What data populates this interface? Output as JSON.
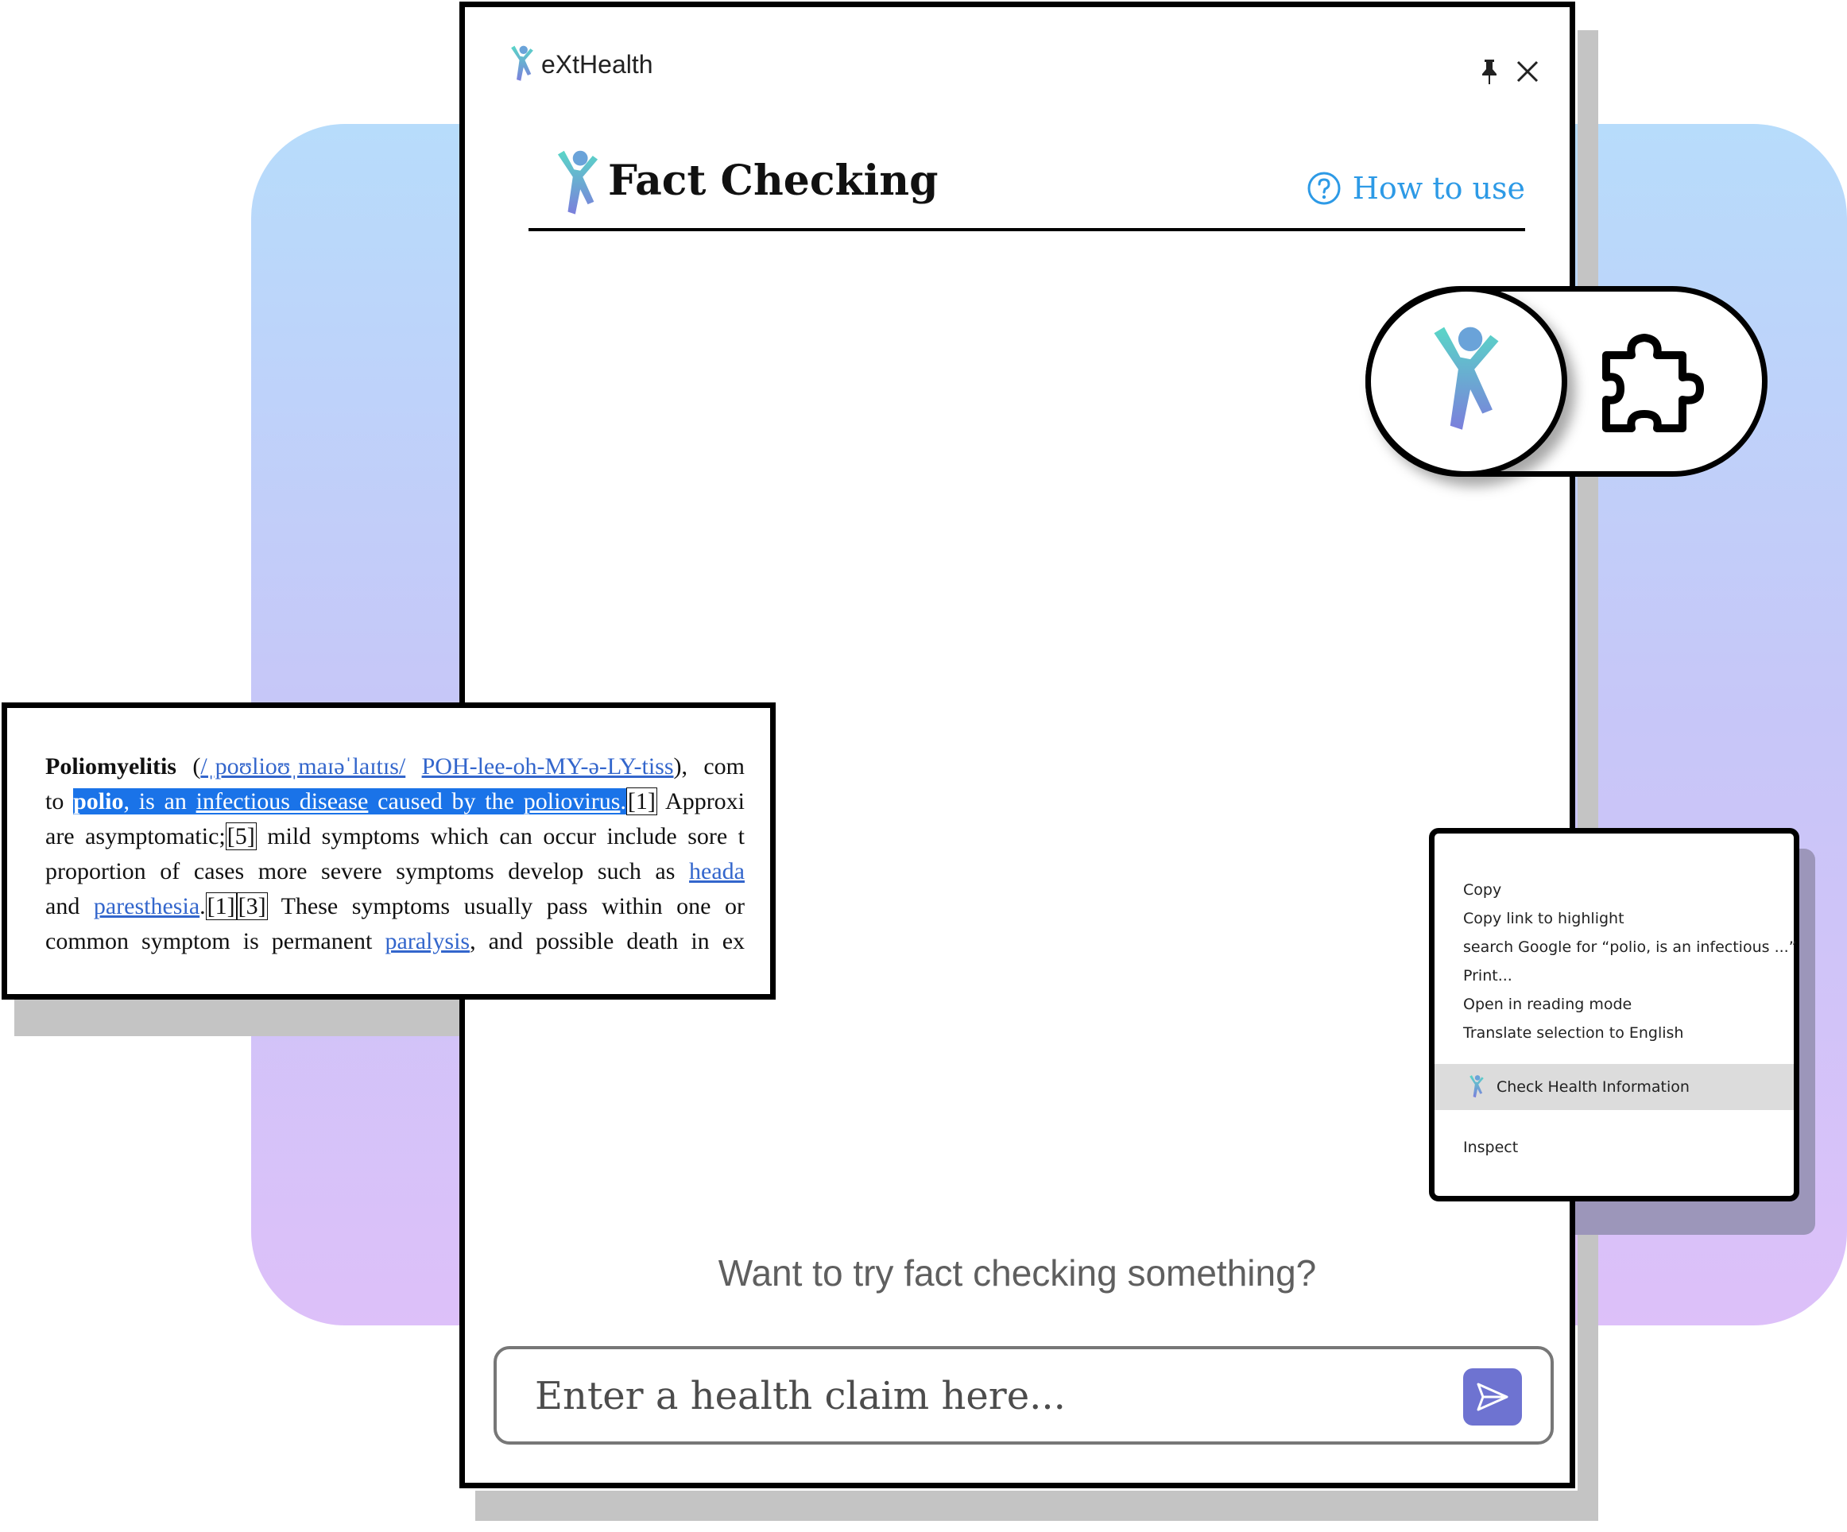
{
  "app": {
    "name": "eXtHealth"
  },
  "panel": {
    "title": "Fact Checking",
    "how_to_use": "How to use",
    "prompt": "Want to try fact checking something?",
    "claim_placeholder": "Enter a health claim here...",
    "accent_color": "#6e73d1",
    "link_color": "#2d9ae6"
  },
  "excerpt": {
    "term": "Poliomyelitis",
    "pronunciation": "/ˌpoʊlioʊˌmaɪəˈlaɪtɪs/",
    "respelling": "POH-lee-oh-MY-ə-LY-tiss",
    "l1_tail": "), com",
    "l2_to": "to",
    "l2_polio": "polio",
    "l2_text1": ", is an",
    "l2_link_infectious": "infectious disease",
    "l2_text2": "caused by the",
    "l2_link_poliovirus": "poliovirus",
    "l2_dot": ".",
    "ref1": "[1]",
    "l2_tail": "Approxi",
    "l3_a": "are asymptomatic;",
    "ref5": "[5]",
    "l3_b": "mild symptoms which can occur include sore t",
    "l4_a": "proportion of cases more severe symptoms develop such as",
    "l4_link": "heada",
    "l5_a": "and",
    "l5_link": "paresthesia",
    "l5_dot": ".",
    "ref1b": "[1]",
    "ref3": "[3]",
    "l5_b": "These symptoms usually pass within one or",
    "l6_a": "common symptom is permanent",
    "l6_link": "paralysis",
    "l6_b": ", and possible death in ex"
  },
  "context_menu": {
    "items": [
      "Copy",
      "Copy link to highlight",
      "search Google for “polio, is an infectious ...”",
      "Print...",
      "Open in reading mode",
      "Translate selection to English"
    ],
    "highlighted": "Check Health Information",
    "last": "Inspect"
  },
  "icons": {
    "brand": "exthealth-logo-icon",
    "pin": "pin-icon",
    "close": "close-icon",
    "help": "help-circle-icon",
    "send": "send-icon",
    "extension": "puzzle-icon"
  }
}
